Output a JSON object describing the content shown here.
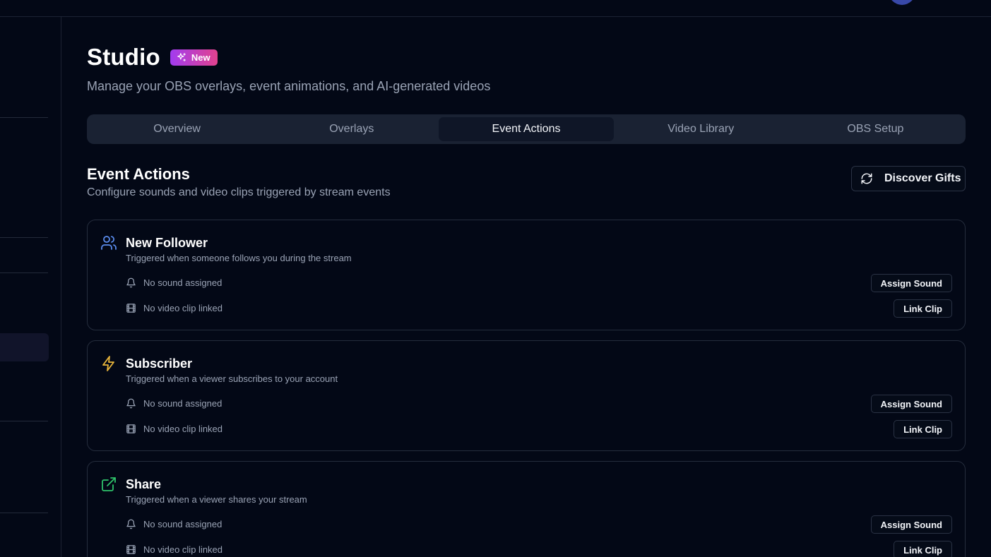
{
  "page": {
    "title": "Studio",
    "badge": "New",
    "subtitle": "Manage your OBS overlays, event animations, and AI-generated videos"
  },
  "tabs": [
    {
      "label": "Overview",
      "active": false
    },
    {
      "label": "Overlays",
      "active": false
    },
    {
      "label": "Event Actions",
      "active": true
    },
    {
      "label": "Video Library",
      "active": false
    },
    {
      "label": "OBS Setup",
      "active": false
    }
  ],
  "section": {
    "title": "Event Actions",
    "subtitle": "Configure sounds and video clips triggered by stream events",
    "discover_label": "Discover Gifts"
  },
  "events": [
    {
      "title": "New Follower",
      "description": "Triggered when someone follows you during the stream",
      "icon": "users-icon",
      "icon_color": "#5b8def",
      "sound_status": "No sound assigned",
      "video_status": "No video clip linked",
      "assign_label": "Assign Sound",
      "link_label": "Link Clip"
    },
    {
      "title": "Subscriber",
      "description": "Triggered when a viewer subscribes to your account",
      "icon": "lightning-icon",
      "icon_color": "#e9b53b",
      "sound_status": "No sound assigned",
      "video_status": "No video clip linked",
      "assign_label": "Assign Sound",
      "link_label": "Link Clip"
    },
    {
      "title": "Share",
      "description": "Triggered when a viewer shares your stream",
      "icon": "external-link-icon",
      "icon_color": "#2fc46b",
      "sound_status": "No sound assigned",
      "video_status": "No video clip linked",
      "assign_label": "Assign Sound",
      "link_label": "Link Clip"
    }
  ],
  "colors": {
    "background": "#030816",
    "badge_gradient_start": "#a23cf0",
    "badge_gradient_end": "#e2428e",
    "tab_bar": "#1a2233"
  }
}
